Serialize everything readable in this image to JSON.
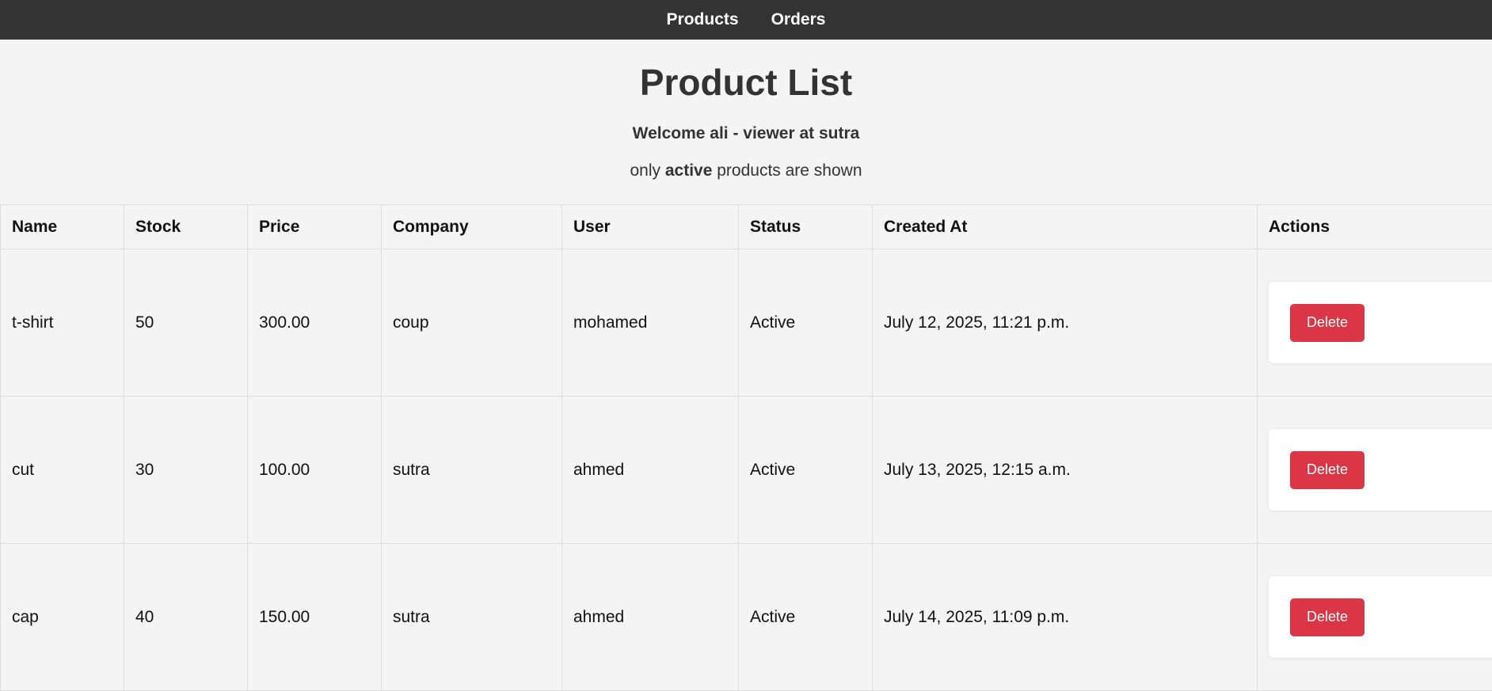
{
  "nav": {
    "items": [
      {
        "label": "Products"
      },
      {
        "label": "Orders"
      }
    ]
  },
  "header": {
    "title": "Product List",
    "welcome": "Welcome ali - viewer at sutra",
    "notice_prefix": "only",
    "notice_bold": "active",
    "notice_suffix": "products are shown"
  },
  "table": {
    "columns": [
      "Name",
      "Stock",
      "Price",
      "Company",
      "User",
      "Status",
      "Created At",
      "Actions"
    ],
    "rows": [
      {
        "name": "t-shirt",
        "stock": "50",
        "price": "300.00",
        "company": "coup",
        "user": "mohamed",
        "status": "Active",
        "created_at": "July 12, 2025, 11:21 p.m.",
        "action_label": "Delete"
      },
      {
        "name": "cut",
        "stock": "30",
        "price": "100.00",
        "company": "sutra",
        "user": "ahmed",
        "status": "Active",
        "created_at": "July 13, 2025, 12:15 a.m.",
        "action_label": "Delete"
      },
      {
        "name": "cap",
        "stock": "40",
        "price": "150.00",
        "company": "sutra",
        "user": "ahmed",
        "status": "Active",
        "created_at": "July 14, 2025, 11:09 p.m.",
        "action_label": "Delete"
      }
    ]
  },
  "colors": {
    "navbar_bg": "#333333",
    "page_bg": "#f4f4f4",
    "delete_button": "#dc3545"
  }
}
